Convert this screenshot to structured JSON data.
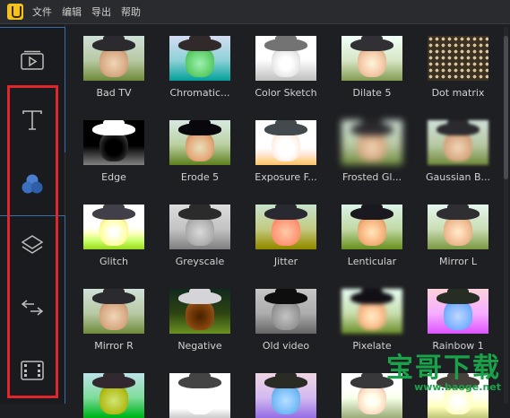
{
  "menubar": {
    "items": [
      "文件",
      "编辑",
      "导出",
      "帮助"
    ]
  },
  "sidebar": {
    "buttons": [
      {
        "name": "media-icon"
      },
      {
        "name": "text-icon"
      },
      {
        "name": "filters-icon"
      },
      {
        "name": "overlays-icon"
      },
      {
        "name": "transitions-icon"
      },
      {
        "name": "elements-icon"
      }
    ],
    "accent": "#3a6ea8",
    "highlight_color": "#e0262b"
  },
  "filters": {
    "items": [
      {
        "label": "Bad TV"
      },
      {
        "label": "Chromatic..."
      },
      {
        "label": "Color Sketch"
      },
      {
        "label": "Dilate 5"
      },
      {
        "label": "Dot matrix"
      },
      {
        "label": "Edge"
      },
      {
        "label": "Erode 5"
      },
      {
        "label": "Exposure F..."
      },
      {
        "label": "Frosted Gl..."
      },
      {
        "label": "Gaussian B..."
      },
      {
        "label": "Glitch"
      },
      {
        "label": "Greyscale"
      },
      {
        "label": "Jitter"
      },
      {
        "label": "Lenticular"
      },
      {
        "label": "Mirror L"
      },
      {
        "label": "Mirror R"
      },
      {
        "label": "Negative"
      },
      {
        "label": "Old video"
      },
      {
        "label": "Pixelate"
      },
      {
        "label": "Rainbow 1"
      }
    ]
  },
  "watermark": {
    "title": "宝哥下载",
    "url": "www.baoge.net"
  }
}
